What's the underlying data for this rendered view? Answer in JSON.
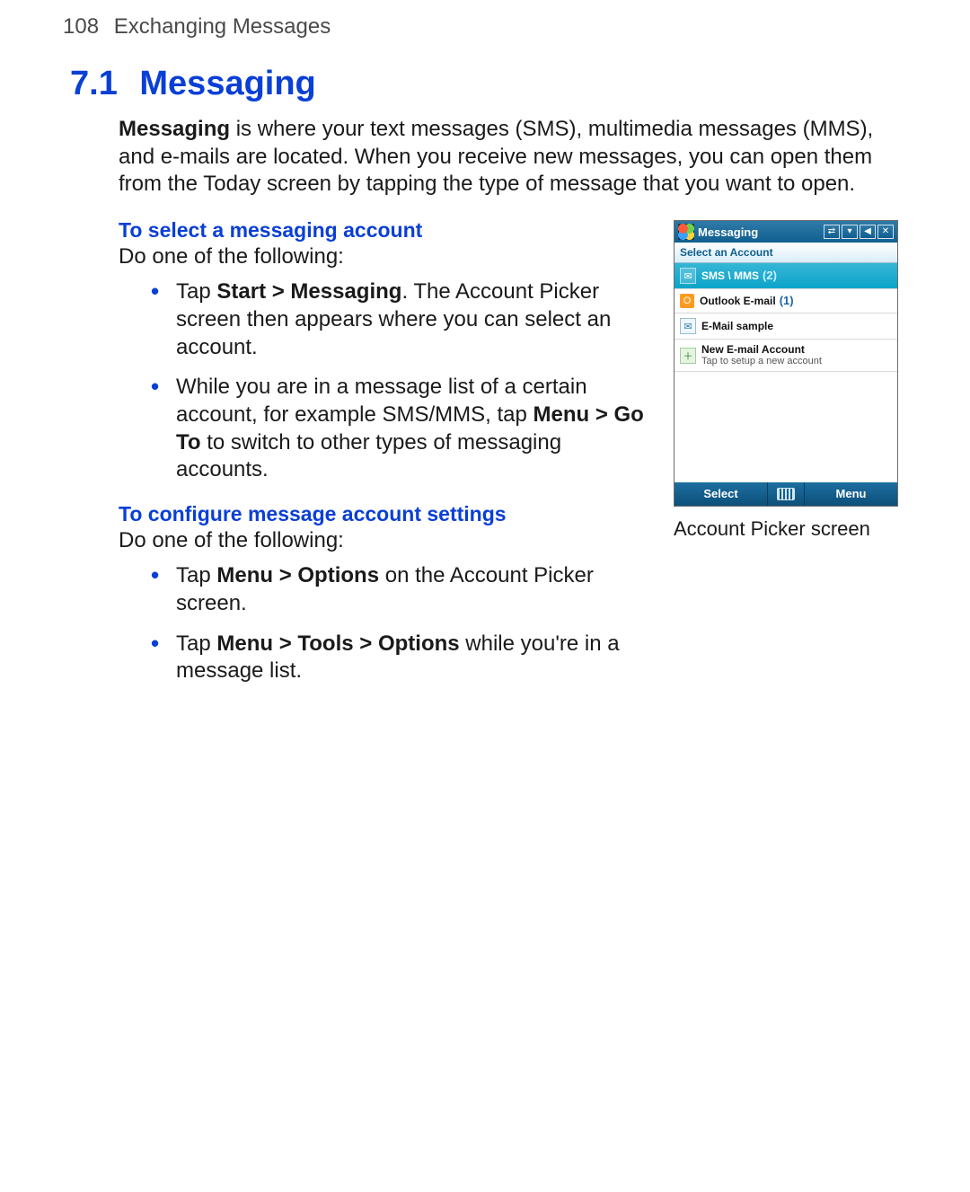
{
  "page": {
    "number": "108",
    "chapter": "Exchanging Messages"
  },
  "section": {
    "number": "7.1",
    "title": "Messaging"
  },
  "intro": {
    "bold_lead": "Messaging",
    "rest": " is where your text messages (SMS), multimedia messages (MMS), and e-mails are located. When you receive new messages, you can open them from the Today screen by tapping the type of message that you want to open."
  },
  "select_account": {
    "heading": "To select a messaging account",
    "lead": "Do one of the following:",
    "items": [
      {
        "pre": "Tap ",
        "bold": "Start > Messaging",
        "post": ". The Account Picker screen then appears where you can select an account."
      },
      {
        "pre": "While you are in a message list of a certain account, for example SMS/MMS, tap ",
        "bold": "Menu > Go To",
        "post": " to switch to other types of messaging accounts."
      }
    ]
  },
  "configure": {
    "heading": "To configure message account settings",
    "lead": "Do one of the following:",
    "items": [
      {
        "pre": "Tap ",
        "bold": "Menu > Options",
        "post": " on the Account Picker screen."
      },
      {
        "pre": "Tap ",
        "bold": "Menu > Tools > Options",
        "post": " while you're in a message list."
      }
    ]
  },
  "phone": {
    "title": "Messaging",
    "subhead": "Select an Account",
    "accounts": [
      {
        "label": "SMS \\ MMS",
        "count": "(2)",
        "selected": true,
        "icon": "sms"
      },
      {
        "label": "Outlook E-mail",
        "count": "(1)",
        "selected": false,
        "icon": "outlook"
      },
      {
        "label": "E-Mail sample",
        "count": "",
        "selected": false,
        "icon": "mail"
      },
      {
        "label": "New E-mail Account",
        "count": "",
        "sub": "Tap to setup a new account",
        "selected": false,
        "icon": "new"
      }
    ],
    "soft_left": "Select",
    "soft_right": "Menu",
    "caption": "Account Picker screen"
  }
}
